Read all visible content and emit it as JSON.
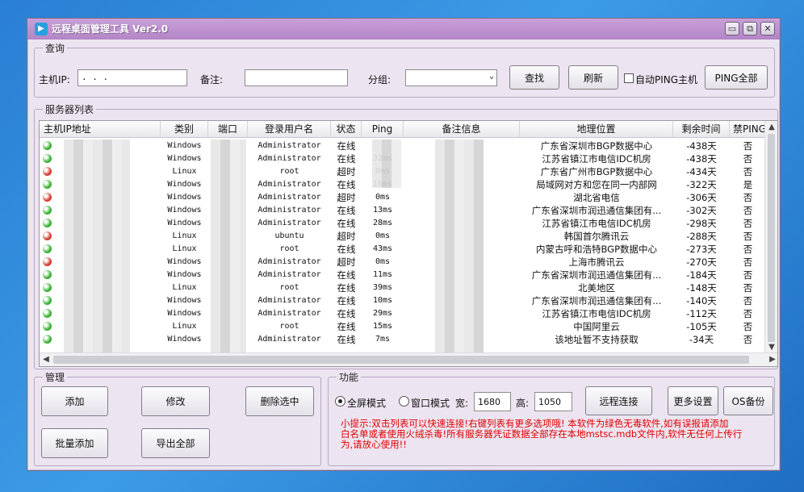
{
  "window": {
    "title": "远程桌面管理工具  Ver2.0",
    "controls": [
      "▭",
      "⧉",
      "✕"
    ]
  },
  "query": {
    "legend": "查询",
    "host_ip_label": "主机IP:",
    "host_ip_value": ".    .    .",
    "remark_label": "备注:",
    "remark_value": "",
    "group_label": "分组:",
    "group_value": "",
    "search_button": "查找",
    "refresh_button": "刷新",
    "auto_ping_label": "自动PING主机",
    "ping_all_button": "PING全部"
  },
  "servers": {
    "legend": "服务器列表",
    "columns": [
      "主机IP地址",
      "类别",
      "端口",
      "登录用户名",
      "状态",
      "Ping",
      "备注信息",
      "地理位置",
      "剩余时间",
      "禁PING"
    ],
    "rows": [
      {
        "status_color": "#35b02f",
        "os": "Windows",
        "user": "Administrator",
        "state": "在线",
        "ping": "",
        "remark": "",
        "location": "广东省深圳市BGP数据中心",
        "remaining": "-438天",
        "noping": "否"
      },
      {
        "status_color": "#35b02f",
        "os": "Windows",
        "user": "Administrator",
        "state": "在线",
        "ping": "32ms",
        "remark": "",
        "location": "江苏省镇江市电信IDC机房",
        "remaining": "-438天",
        "noping": "否"
      },
      {
        "status_color": "#d63a2e",
        "os": "Linux",
        "user": "root",
        "state": "超时",
        "ping": "0ms",
        "remark": "",
        "location": "广东省广州市BGP数据中心",
        "remaining": "-434天",
        "noping": "否"
      },
      {
        "status_color": "#35b02f",
        "os": "Windows",
        "user": "Administrator",
        "state": "在线",
        "ping": "16ms",
        "remark": "",
        "location": "局域网对方和您在同一内部网",
        "remaining": "-322天",
        "noping": "是"
      },
      {
        "status_color": "#d63a2e",
        "os": "Windows",
        "user": "Administrator",
        "state": "超时",
        "ping": "0ms",
        "remark": "",
        "location": "湖北省电信",
        "remaining": "-306天",
        "noping": "否"
      },
      {
        "status_color": "#35b02f",
        "os": "Windows",
        "user": "Administrator",
        "state": "在线",
        "ping": "13ms",
        "remark": "",
        "location": "广东省深圳市润迅通信集团有...",
        "remaining": "-302天",
        "noping": "否"
      },
      {
        "status_color": "#35b02f",
        "os": "Windows",
        "user": "Administrator",
        "state": "在线",
        "ping": "28ms",
        "remark": "",
        "location": "江苏省镇江市电信IDC机房",
        "remaining": "-298天",
        "noping": "否"
      },
      {
        "status_color": "#d63a2e",
        "os": "Linux",
        "user": "ubuntu",
        "state": "超时",
        "ping": "0ms",
        "remark": "",
        "location": "韩国首尔腾讯云",
        "remaining": "-288天",
        "noping": "否"
      },
      {
        "status_color": "#35b02f",
        "os": "Linux",
        "user": "root",
        "state": "在线",
        "ping": "43ms",
        "remark": "",
        "location": "内蒙古呼和浩特BGP数据中心",
        "remaining": "-273天",
        "noping": "否"
      },
      {
        "status_color": "#d63a2e",
        "os": "Windows",
        "user": "Administrator",
        "state": "超时",
        "ping": "0ms",
        "remark": "",
        "location": "上海市腾讯云",
        "remaining": "-270天",
        "noping": "否"
      },
      {
        "status_color": "#35b02f",
        "os": "Windows",
        "user": "Administrator",
        "state": "在线",
        "ping": "11ms",
        "remark": "",
        "location": "广东省深圳市润迅通信集团有...",
        "remaining": "-184天",
        "noping": "否"
      },
      {
        "status_color": "#35b02f",
        "os": "Linux",
        "user": "root",
        "state": "在线",
        "ping": "39ms",
        "remark": "",
        "location": "北美地区",
        "remaining": "-148天",
        "noping": "否"
      },
      {
        "status_color": "#35b02f",
        "os": "Windows",
        "user": "Administrator",
        "state": "在线",
        "ping": "10ms",
        "remark": "",
        "location": "广东省深圳市润迅通信集团有...",
        "remaining": "-140天",
        "noping": "否"
      },
      {
        "status_color": "#35b02f",
        "os": "Windows",
        "user": "Administrator",
        "state": "在线",
        "ping": "29ms",
        "remark": "",
        "location": "江苏省镇江市电信IDC机房",
        "remaining": "-112天",
        "noping": "否"
      },
      {
        "status_color": "#35b02f",
        "os": "Linux",
        "user": "root",
        "state": "在线",
        "ping": "15ms",
        "remark": "",
        "location": "中国阿里云",
        "remaining": "-105天",
        "noping": "否"
      },
      {
        "status_color": "#35b02f",
        "os": "Windows",
        "user": "Administrator",
        "state": "在线",
        "ping": "7ms",
        "remark": "",
        "location": "该地址暂不支持获取",
        "remaining": "-34天",
        "noping": "否"
      }
    ]
  },
  "manage": {
    "legend": "管理",
    "add_button": "添加",
    "edit_button": "修改",
    "delete_button": "删除选中",
    "batch_add_button": "批量添加",
    "export_button": "导出全部"
  },
  "functions": {
    "legend": "功能",
    "fullscreen_label": "全屏模式",
    "window_label": "窗口模式",
    "width_label": "宽:",
    "width_value": "1680",
    "height_label": "高:",
    "height_value": "1050",
    "connect_button": "远程连接",
    "more_settings_button": "更多设置",
    "backup_button": "OS备份",
    "tip_lines": [
      "小提示:双击列表可以快速连接!右键列表有更多选项哦!   本软件为绿色无毒软件,如有误报请添加",
      "白名单或者使用火绒杀毒!所有服务器凭证数据全部存在本地mstsc.mdb文件内,软件无任何上传行",
      "为,请放心使用!!"
    ]
  }
}
